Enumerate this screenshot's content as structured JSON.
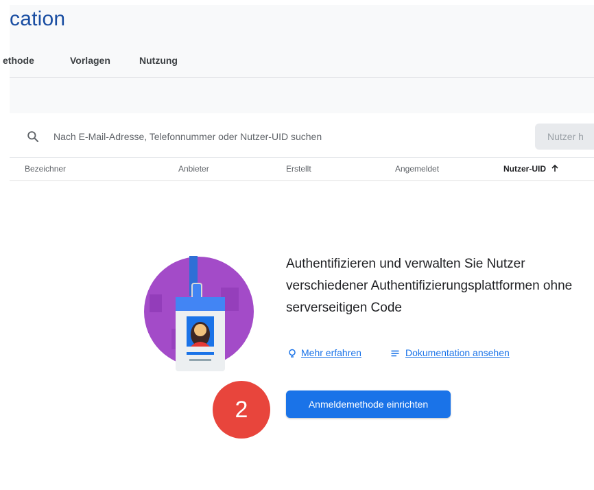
{
  "header": {
    "title": "cation",
    "tabs": [
      "ethode",
      "Vorlagen",
      "Nutzung"
    ]
  },
  "search": {
    "placeholder": "Nach E-Mail-Adresse, Telefonnummer oder Nutzer-UID suchen",
    "add_user_label": "Nutzer h"
  },
  "table": {
    "columns": [
      "Bezeichner",
      "Anbieter",
      "Erstellt",
      "Angemeldet",
      "Nutzer-UID"
    ],
    "sort_column": "Nutzer-UID",
    "sort_direction": "ascending"
  },
  "empty_state": {
    "title": "Authentifizieren und verwalten Sie Nutzer verschiedener Authentifizierungsplattformen ohne serverseitigen Code",
    "learn_more_label": "Mehr erfahren",
    "docs_label": "Dokumentation ansehen",
    "cta_label": "Anmeldemethode einrichten"
  },
  "overlay": {
    "step_number": "2"
  },
  "colors": {
    "title": "#1a4ea2",
    "primary": "#1a73e8",
    "badge": "#e8453c",
    "illustration": "#a34bc8"
  },
  "icons": {
    "search": "search-icon",
    "learn_more": "lightbulb-icon",
    "docs": "document-lines-icon",
    "sort": "arrow-up-icon"
  }
}
